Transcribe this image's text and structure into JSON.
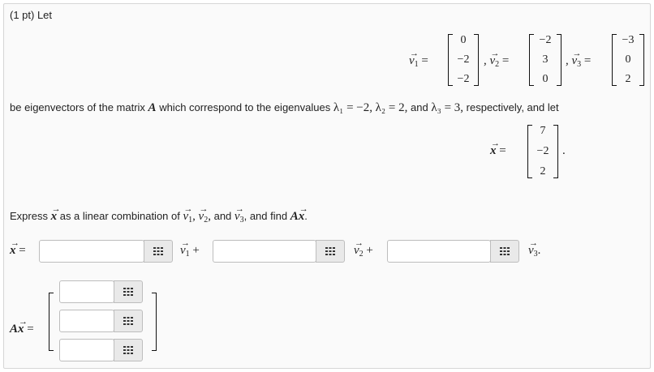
{
  "problem": {
    "points_label": "(1 pt) Let",
    "eigen_text": "be eigenvectors of the matrix",
    "eigen_text2": "which correspond to the eigenvalues",
    "lambda1_eq": "λ₁ = −2,",
    "lambda2_eq": "λ₂ = 2,",
    "and_word": "and",
    "lambda3_eq": "λ₃ = 3,",
    "tail_text": "respectively, and let",
    "matrix_name": "A",
    "express_text": "Express",
    "express_mid": "as a linear combination of",
    "express_and": "and",
    "express_find": ", and find",
    "express_end": "."
  },
  "vectors": {
    "v1": {
      "label": "v",
      "sub": "1",
      "values": [
        "0",
        "−2",
        "−2"
      ]
    },
    "v2": {
      "label": "v",
      "sub": "2",
      "values": [
        "−2",
        "3",
        "0"
      ]
    },
    "v3": {
      "label": "v",
      "sub": "3",
      "values": [
        "−3",
        "0",
        "2"
      ]
    },
    "x": {
      "label": "x",
      "values": [
        "7",
        "−2",
        "2"
      ]
    }
  },
  "symbols": {
    "equals": "=",
    "comma": ",",
    "plus": "+",
    "period": ".",
    "x": "x",
    "v": "v",
    "A": "A",
    "sub1": "1",
    "sub2": "2",
    "sub3": "3"
  },
  "answers": {
    "coef1": {
      "value": "",
      "placeholder": ""
    },
    "coef2": {
      "value": "",
      "placeholder": ""
    },
    "coef3": {
      "value": "",
      "placeholder": ""
    },
    "ax_row1": {
      "value": "",
      "placeholder": ""
    },
    "ax_row2": {
      "value": "",
      "placeholder": ""
    },
    "ax_row3": {
      "value": "",
      "placeholder": ""
    }
  },
  "icons": {
    "palette": "equation-palette-icon"
  },
  "colors": {
    "panel_bg": "#fafafa",
    "border": "#d6d6d6",
    "button_bg": "#e9e9e9"
  }
}
